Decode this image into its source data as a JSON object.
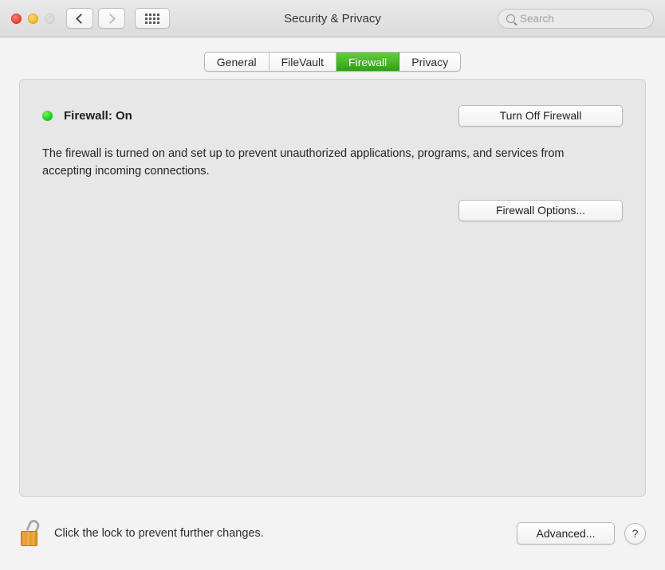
{
  "window": {
    "title": "Security & Privacy"
  },
  "titlebar": {
    "traffic_lights": [
      {
        "name": "close",
        "color": "#f34a3c"
      },
      {
        "name": "minimize",
        "color": "#f7bd2e"
      },
      {
        "name": "zoom",
        "color": "#dedede",
        "state": "disabled"
      }
    ],
    "nav": {
      "back_icon": "chevron-left-icon",
      "forward_icon": "chevron-right-icon",
      "forward_state": "disabled"
    },
    "grid_icon": "show-all-grid-icon"
  },
  "search": {
    "icon": "search-icon",
    "value": "",
    "placeholder": "Search"
  },
  "tabs": [
    {
      "label": "General",
      "selected": false
    },
    {
      "label": "FileVault",
      "selected": false
    },
    {
      "label": "Firewall",
      "selected": true
    },
    {
      "label": "Privacy",
      "selected": false
    }
  ],
  "panel": {
    "status": {
      "dot_color": "#1fd321",
      "label": "Firewall: On"
    },
    "turn_off_button": "Turn Off Firewall",
    "description": "The firewall is turned on and set up to prevent unauthorized applications, programs, and services from accepting incoming connections.",
    "firewall_options_button": "Firewall Options..."
  },
  "bottombar": {
    "lock_icon": "lock-open-icon",
    "lock_text": "Click the lock to prevent further changes.",
    "advanced_button": "Advanced...",
    "help_button": "?"
  },
  "colors": {
    "accent_green": "#4cbb2a",
    "status_green": "#1fd321",
    "lock_gold": "#e5a12f",
    "window_bg": "#f3f3f3",
    "panel_bg": "#e7e7e7"
  }
}
